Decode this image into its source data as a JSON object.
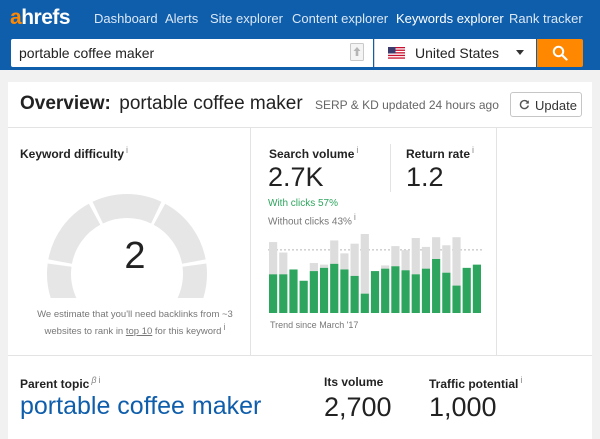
{
  "nav": {
    "logo_a": "a",
    "logo_rest": "hrefs",
    "items": [
      {
        "label": "Dashboard"
      },
      {
        "label": "Alerts"
      },
      {
        "label": "Site explorer"
      },
      {
        "label": "Content explorer"
      },
      {
        "label": "Keywords explorer",
        "active": true
      },
      {
        "label": "Rank tracker"
      }
    ]
  },
  "search": {
    "value": "portable coffee maker",
    "country": "United States"
  },
  "overview": {
    "title": "Overview:",
    "keyword": "portable coffee maker",
    "updated": "SERP & KD updated 24 hours ago",
    "update_label": "Update"
  },
  "kd": {
    "label": "Keyword difficulty",
    "info": "i",
    "value": "2",
    "score": 2,
    "note_pre": "We estimate that you'll need backlinks from ~3 websites to rank in",
    "note_link": "top 10",
    "note_post": "for this keyword",
    "colors": {
      "track": "#e6e6e6",
      "fill": "#2ea55e"
    }
  },
  "volume": {
    "label": "Search volume",
    "info": "i",
    "value": "2.7K",
    "with_clicks": "With clicks 57%",
    "without_clicks": "Without clicks 43%",
    "trend_label": "Trend since March '17"
  },
  "return_rate": {
    "label": "Return rate",
    "info": "i",
    "value": "1.2"
  },
  "parent": {
    "label": "Parent topic",
    "beta": "β",
    "info": "i",
    "keyword": "portable coffee maker"
  },
  "its_volume": {
    "label": "Its volume",
    "value": "2,700"
  },
  "traffic": {
    "label": "Traffic potential",
    "info": "i",
    "value": "1,000"
  },
  "chart_data": {
    "type": "bar",
    "title": "",
    "series": [
      {
        "values": [
          48,
          48,
          54,
          40,
          52,
          56,
          61,
          54,
          46,
          24,
          52,
          55,
          58,
          53,
          48,
          55,
          67,
          50,
          34,
          56,
          60
        ]
      },
      {
        "values": [
          40,
          27,
          0,
          0,
          10,
          4,
          29,
          20,
          40,
          74,
          0,
          4,
          25,
          25,
          45,
          27,
          27,
          34,
          60,
          0,
          0
        ]
      }
    ],
    "colors": [
      "#2ea55e",
      "#dddddd"
    ],
    "grid": false
  }
}
